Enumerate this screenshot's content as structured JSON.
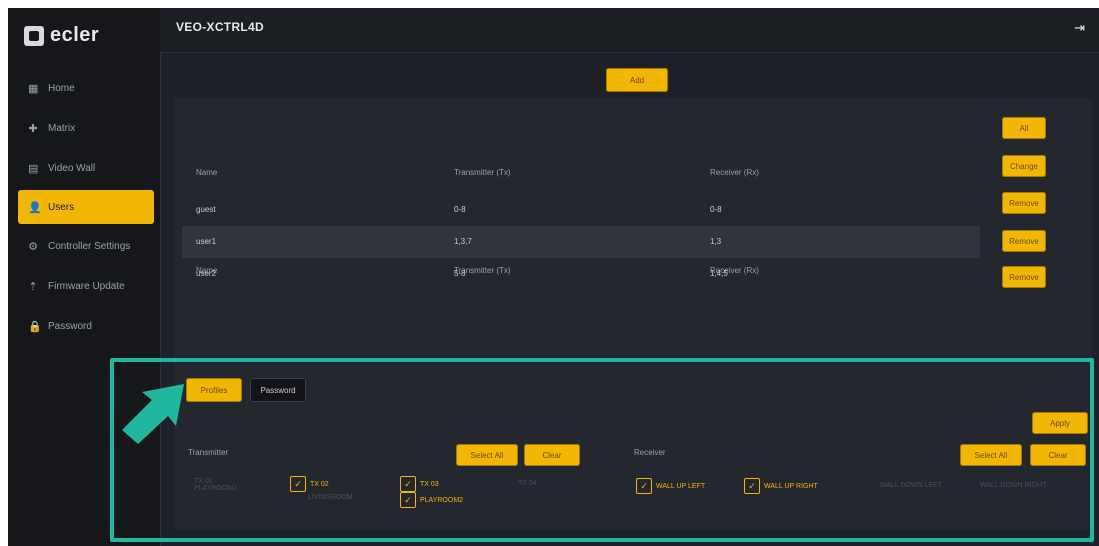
{
  "header": {
    "title": "VEO-XCTRL4D"
  },
  "logo": {
    "text": "ecler"
  },
  "sidebar": {
    "items": [
      {
        "label": "Home",
        "icon": "▦"
      },
      {
        "label": "Matrix",
        "icon": "✚"
      },
      {
        "label": "Video Wall",
        "icon": "▤"
      },
      {
        "label": "Users",
        "icon": "👤"
      },
      {
        "label": "Controller Settings",
        "icon": "⚙"
      },
      {
        "label": "Firmware Update",
        "icon": "⇡"
      },
      {
        "label": "Password",
        "icon": "🔒"
      }
    ],
    "active_index": 3
  },
  "toolbar": {
    "add_label": "Add"
  },
  "table": {
    "columns": [
      "Name",
      "Transmitter (Tx)",
      "Receiver (Rx)"
    ],
    "rows": [
      {
        "name": "guest",
        "tx": "0-8",
        "rx": "0-8"
      },
      {
        "name": "user1",
        "tx": "1,3,7",
        "rx": "1,3"
      },
      {
        "name": "user2",
        "tx": "5-8",
        "rx": "1,4,5"
      }
    ],
    "side_buttons": [
      "All",
      "Change",
      "Remove",
      "Remove",
      "Remove"
    ]
  },
  "tabs": {
    "active": "Profiles",
    "inactive": "Password"
  },
  "sections": {
    "transmitter": {
      "label": "Transmitter",
      "select_all": "Select All",
      "clear": "Clear"
    },
    "receiver": {
      "label": "Receiver",
      "select_all": "Select All",
      "clear": "Clear"
    },
    "apply_label": "Apply"
  },
  "checkboxes": {
    "tx_ghost_1": "TX 01",
    "tx_ghost_1b": "PLAYROOM1",
    "tx_2": "TX 02",
    "tx_2b": "LIVINGROOM",
    "tx_3": "TX 03",
    "tx_3b": "PLAYROOM2",
    "tx_ghost_4": "TX 04",
    "rx_1": "WALL UP LEFT",
    "rx_2": "WALL UP RIGHT",
    "rx_ghost_3": "WALL DOWN LEFT",
    "rx_ghost_4": "WALL DOWN RIGHT"
  },
  "colors": {
    "accent": "#f2b705",
    "highlight": "#1fb89e",
    "background": "#1e2127"
  }
}
